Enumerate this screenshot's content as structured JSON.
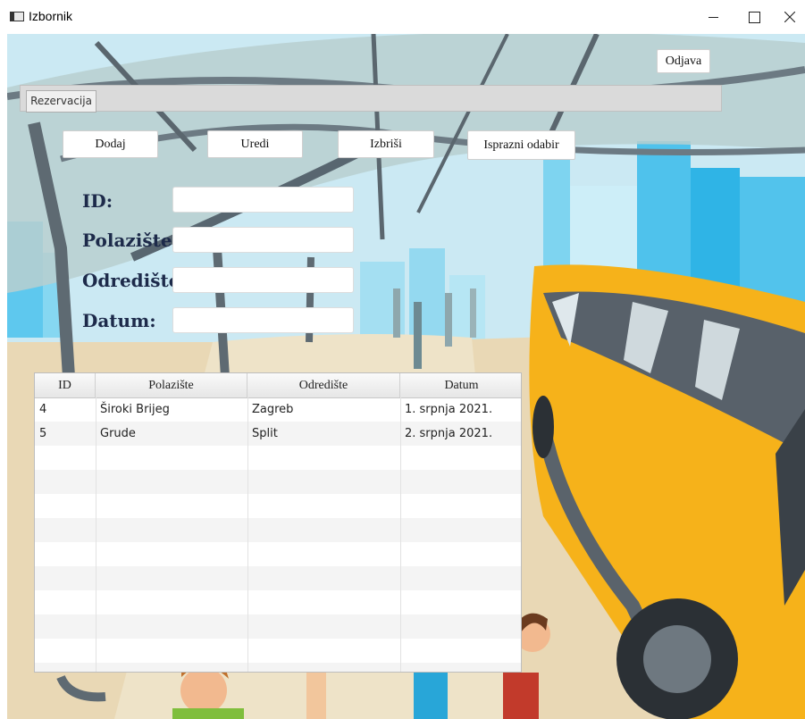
{
  "window": {
    "title": "Izbornik"
  },
  "toolbar": {
    "logout_label": "Odjava"
  },
  "tabs": [
    {
      "label": "Rezervacija"
    }
  ],
  "actions": {
    "add": "Dodaj",
    "edit": "Uredi",
    "delete": "Izbriši",
    "clear": "Isprazni odabir"
  },
  "form": {
    "id": {
      "label": "ID:",
      "value": ""
    },
    "from": {
      "label": "Polazište:",
      "value": ""
    },
    "to": {
      "label": "Odredište:",
      "value": ""
    },
    "date": {
      "label": "Datum:",
      "value": ""
    }
  },
  "table": {
    "headers": [
      "ID",
      "Polazište",
      "Odredište",
      "Datum"
    ],
    "rows": [
      [
        "4",
        "Široki Brijeg",
        "Zagreb",
        "1. srpnja 2021."
      ],
      [
        "5",
        "Grude",
        "Split",
        "2. srpnja 2021."
      ]
    ]
  },
  "colors": {
    "sky": "#c9e8f2",
    "bus_yellow": "#f6b21a",
    "label_navy": "#1d2a4a"
  }
}
